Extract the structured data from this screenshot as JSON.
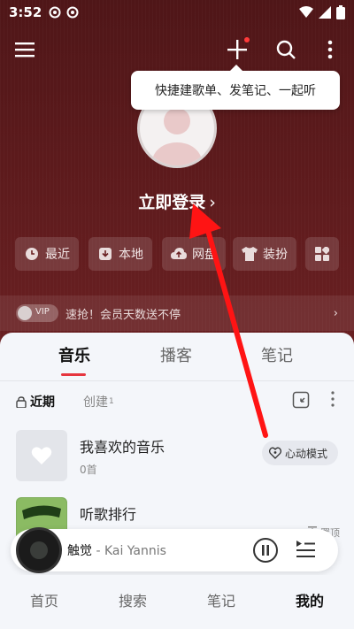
{
  "status_bar": {
    "time": "3:52"
  },
  "tooltip": {
    "text": "快捷建歌单、发笔记、一起听"
  },
  "profile": {
    "login_label": "立即登录",
    "login_chevron": "›"
  },
  "quick_actions": [
    {
      "label": "最近",
      "icon": "clock-icon"
    },
    {
      "label": "本地",
      "icon": "download-box-icon"
    },
    {
      "label": "网盘",
      "icon": "cloud-upload-icon"
    },
    {
      "label": "装扮",
      "icon": "shirt-icon"
    },
    {
      "label": "",
      "icon": "apps-grid-icon"
    }
  ],
  "vip": {
    "badge": "VIP",
    "text": "速抢！会员天数送不停",
    "arrow": "›"
  },
  "tabs": [
    {
      "label": "音乐",
      "active": true
    },
    {
      "label": "播客",
      "active": false
    },
    {
      "label": "笔记",
      "active": false
    }
  ],
  "subtabs": {
    "recent": "近期",
    "created": "创建",
    "created_count": "1"
  },
  "playlists": [
    {
      "title": "我喜欢的音乐",
      "subtitle": "0首",
      "action": "心动模式"
    },
    {
      "title": "听歌排行",
      "subtitle": "",
      "action": "置顶"
    }
  ],
  "player": {
    "song": "触觉",
    "separator": " - ",
    "artist": "Kai Yannis"
  },
  "bottom_nav": [
    {
      "label": "首页",
      "active": false
    },
    {
      "label": "搜索",
      "active": false
    },
    {
      "label": "笔记",
      "active": false
    },
    {
      "label": "我的",
      "active": true
    }
  ],
  "colors": {
    "hero_bg": "#5a1a1c",
    "accent_red": "#e6353e",
    "annotation_arrow": "#ff1414",
    "panel_bg": "#f4f6fa"
  }
}
